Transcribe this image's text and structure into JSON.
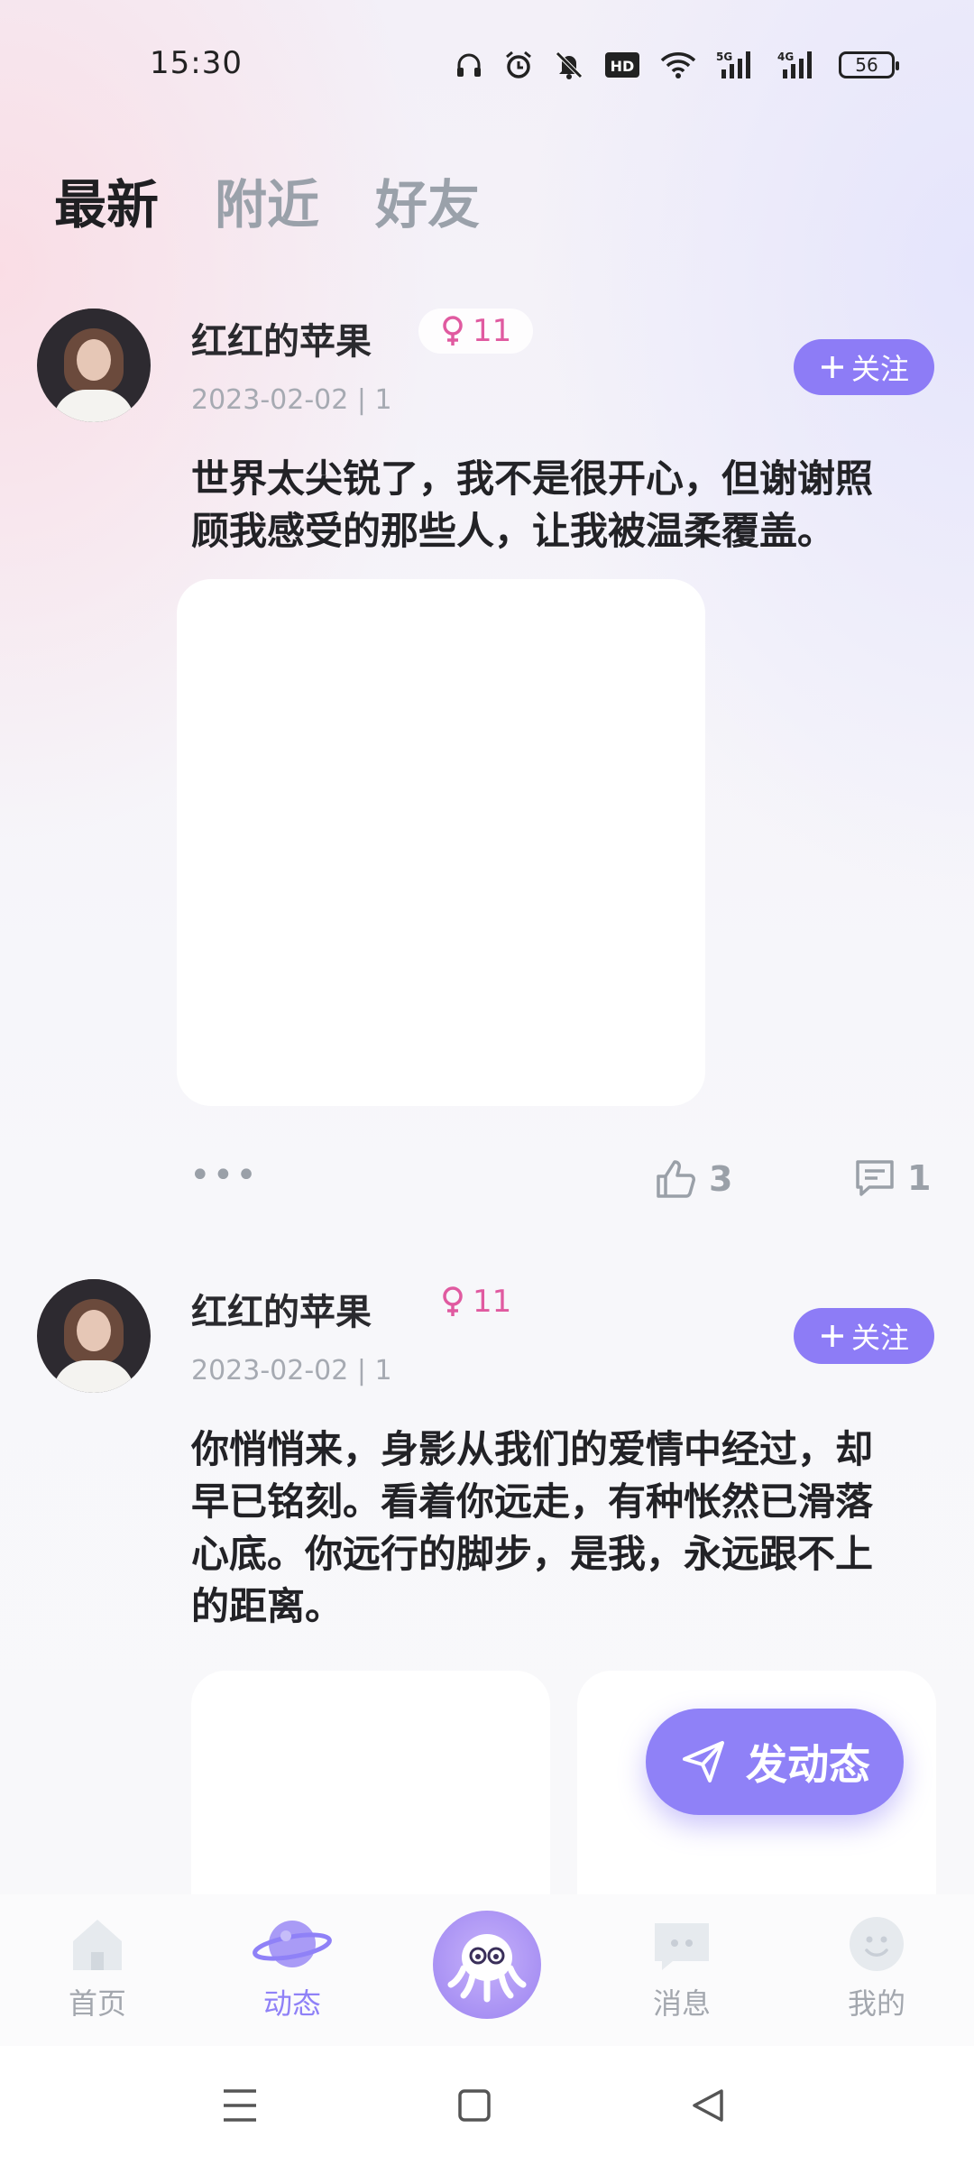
{
  "status_bar": {
    "time": "15:30",
    "battery": "56",
    "icons": [
      "headphones-icon",
      "alarm-icon",
      "mute-icon",
      "hd-icon",
      "wifi-icon",
      "signal-5g-icon",
      "signal-4g-icon",
      "battery-icon"
    ]
  },
  "tabs": [
    {
      "label": "最新",
      "active": true
    },
    {
      "label": "附近",
      "active": false
    },
    {
      "label": "好友",
      "active": false
    }
  ],
  "posts": [
    {
      "name": "红红的苹果",
      "gender": "11",
      "meta": "2023-02-02 | 1",
      "follow": "关注",
      "content_lines": [
        "世界太尖锐了，我不是很开心，但谢谢照",
        "顾我感受的那些人，让我被温柔覆盖。"
      ],
      "likes": "3",
      "comments": "1"
    },
    {
      "name": "红红的苹果",
      "gender": "11",
      "meta": "2023-02-02 | 1",
      "follow": "关注",
      "content_lines": [
        "你悄悄来，身影从我们的爱情中经过，却",
        "早已铭刻。看着你远走，有种怅然已滑落",
        "心底。你远行的脚步，是我，永远跟不上",
        "的距离。"
      ]
    }
  ],
  "fab": {
    "label": "发动态"
  },
  "nav": [
    {
      "label": "首页",
      "icon": "home-icon"
    },
    {
      "label": "动态",
      "icon": "planet-icon",
      "active": true
    },
    {
      "label": "",
      "icon": "octopus-icon"
    },
    {
      "label": "消息",
      "icon": "message-icon"
    },
    {
      "label": "我的",
      "icon": "profile-icon"
    }
  ],
  "colors": {
    "accent": "#8f81f7",
    "female": "#e05aa0"
  }
}
